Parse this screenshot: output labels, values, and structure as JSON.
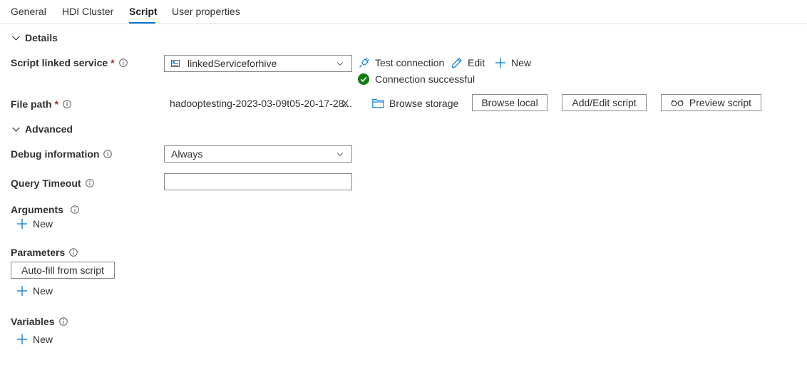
{
  "tabs": [
    {
      "label": "General"
    },
    {
      "label": "HDI Cluster"
    },
    {
      "label": "Script"
    },
    {
      "label": "User properties"
    }
  ],
  "active_tab": "Script",
  "sections": {
    "details": "Details",
    "advanced": "Advanced"
  },
  "script_linked_service": {
    "label": "Script linked service",
    "required": "*",
    "value": "linkedServiceforhive",
    "test_connection": "Test connection",
    "edit": "Edit",
    "new": "New",
    "status": "Connection successful"
  },
  "file_path": {
    "label": "File path",
    "required": "*",
    "value": "hadooptesting-2023-03-09t05-20-17-28...",
    "clear": "X",
    "browse_storage": "Browse storage",
    "browse_local": "Browse local",
    "add_edit_script": "Add/Edit script",
    "preview_script": "Preview script"
  },
  "debug_information": {
    "label": "Debug information",
    "value": "Always"
  },
  "query_timeout": {
    "label": "Query Timeout",
    "value": ""
  },
  "arguments": {
    "label": "Arguments",
    "new": "New"
  },
  "parameters": {
    "label": "Parameters",
    "autofill": "Auto-fill from script",
    "new": "New"
  },
  "variables": {
    "label": "Variables",
    "new": "New"
  },
  "colors": {
    "accent": "#0078d4",
    "required": "#a4262c",
    "success": "#107c10",
    "border": "#8a8886"
  }
}
